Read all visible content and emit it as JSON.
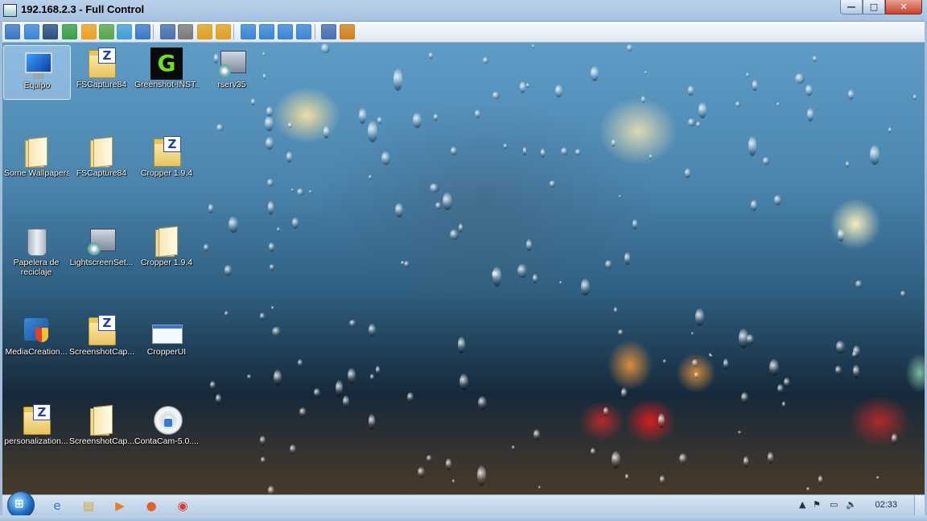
{
  "window": {
    "title": "192.168.2.3 - Full Control",
    "controls": {
      "minimize": "—",
      "maximize": "□",
      "close": "✕"
    }
  },
  "toolbar": {
    "buttons": [
      {
        "icon": "remote-screen-icon",
        "color": "#3a78c8"
      },
      {
        "icon": "monitor-icon",
        "color": "#3a86d6"
      },
      {
        "icon": "terminal-icon",
        "color": "#2f4f7f"
      },
      {
        "icon": "file-transfer-icon",
        "color": "#3aa048"
      },
      {
        "icon": "power-icon",
        "color": "#f0a020"
      },
      {
        "icon": "chat-icon",
        "color": "#58a848"
      },
      {
        "icon": "phone-icon",
        "color": "#3f9fd8"
      },
      {
        "icon": "message-icon",
        "color": "#3a78c8"
      },
      {
        "icon": "upload-icon",
        "color": "#4a70b0"
      },
      {
        "icon": "network-icon",
        "color": "#7a7a7a"
      },
      {
        "icon": "lock-icon",
        "color": "#e0a020"
      },
      {
        "icon": "unlock-icon",
        "color": "#e0a020"
      },
      {
        "icon": "window-mode-icon",
        "color": "#3a86d6"
      },
      {
        "icon": "fit-screen-icon",
        "color": "#3a86d6"
      },
      {
        "icon": "fullscreen-icon",
        "color": "#3a86d6"
      },
      {
        "icon": "stretch-icon",
        "color": "#3a86d6"
      },
      {
        "icon": "copy-icon",
        "color": "#4a70b0"
      },
      {
        "icon": "tools-icon",
        "color": "#d08020"
      }
    ]
  },
  "desktop": {
    "icons": [
      {
        "label": "Equipo",
        "kind": "computer-icon"
      },
      {
        "label": "FSCapture84",
        "kind": "zip-folder-icon"
      },
      {
        "label": "Greenshot-INST...",
        "kind": "greenshot-icon"
      },
      {
        "label": "rserv35",
        "kind": "setup-icon"
      },
      {
        "label": "Some Wallpapers",
        "kind": "folder-icon"
      },
      {
        "label": "FSCapture84",
        "kind": "folder-icon"
      },
      {
        "label": "Cropper 1.9.4",
        "kind": "zip-folder-icon"
      },
      {
        "label": "Papelera de reciclaje",
        "kind": "recycle-bin-icon"
      },
      {
        "label": "LightscreenSet...",
        "kind": "setup-icon"
      },
      {
        "label": "Cropper 1.9.4",
        "kind": "folder-icon"
      },
      {
        "label": "MediaCreation...",
        "kind": "installer-shield-icon"
      },
      {
        "label": "ScreenshotCap...",
        "kind": "zip-folder-icon"
      },
      {
        "label": "CropperUI",
        "kind": "window-app-icon"
      },
      {
        "label": "personalization...",
        "kind": "zip-folder-icon"
      },
      {
        "label": "ScreenshotCap...",
        "kind": "folder-icon"
      },
      {
        "label": "ContaCam-5.0....",
        "kind": "disc-installer-icon"
      }
    ]
  },
  "taskbar": {
    "start_glyph": "⊞",
    "apps": [
      {
        "name": "internet-explorer-icon",
        "glyph": "e",
        "color": "#2a7ad8"
      },
      {
        "name": "file-explorer-icon",
        "glyph": "▤",
        "color": "#d6a730"
      },
      {
        "name": "media-player-icon",
        "glyph": "▶",
        "color": "#e08020"
      },
      {
        "name": "firefox-icon",
        "glyph": "●",
        "color": "#e0622a"
      },
      {
        "name": "chrome-icon",
        "glyph": "◉",
        "color": "#d93a30"
      }
    ],
    "tray": {
      "expand": "▲",
      "flag": "⚑",
      "network": "▭",
      "volume": "🔈"
    },
    "clock": "02:33"
  }
}
